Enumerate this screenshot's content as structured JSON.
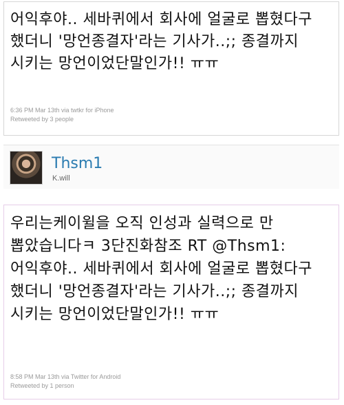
{
  "tweet1": {
    "text": "어익후야.. 세바퀴에서 회사에 얼굴로 뽑혔다구 했더니 '망언종결자'라는 기사가..;; 종결까지 시키는 망언이었단말인가!! ㅠㅠ",
    "timestamp": "6:36 PM Mar 13th via twtkr for iPhone",
    "retweeted": "Retweeted by 3 people"
  },
  "author": {
    "name": "Thsm1",
    "screen_name": "K.will"
  },
  "tweet2": {
    "text_part1": "우리는케이윌을 오직 인성과 실력으로 만 뽑았습니다ㅋ 3단진화참조 RT ",
    "mention": "@Thsm1",
    "text_part2": ": 어익후야.. 세바퀴에서 회사에 얼굴로 뽑혔다구 했더니 '망언종결자'라는 기사가..;; 종결까지 시키는 망언이었단말인가!! ㅠㅠ",
    "timestamp": "8:58 PM Mar 13th via Twitter for Android",
    "retweeted": "Retweeted by 1 person"
  },
  "colors": {
    "author_name": "#2a7bb0",
    "meta_text": "#9a9a9a",
    "tweet_text": "#111111"
  }
}
